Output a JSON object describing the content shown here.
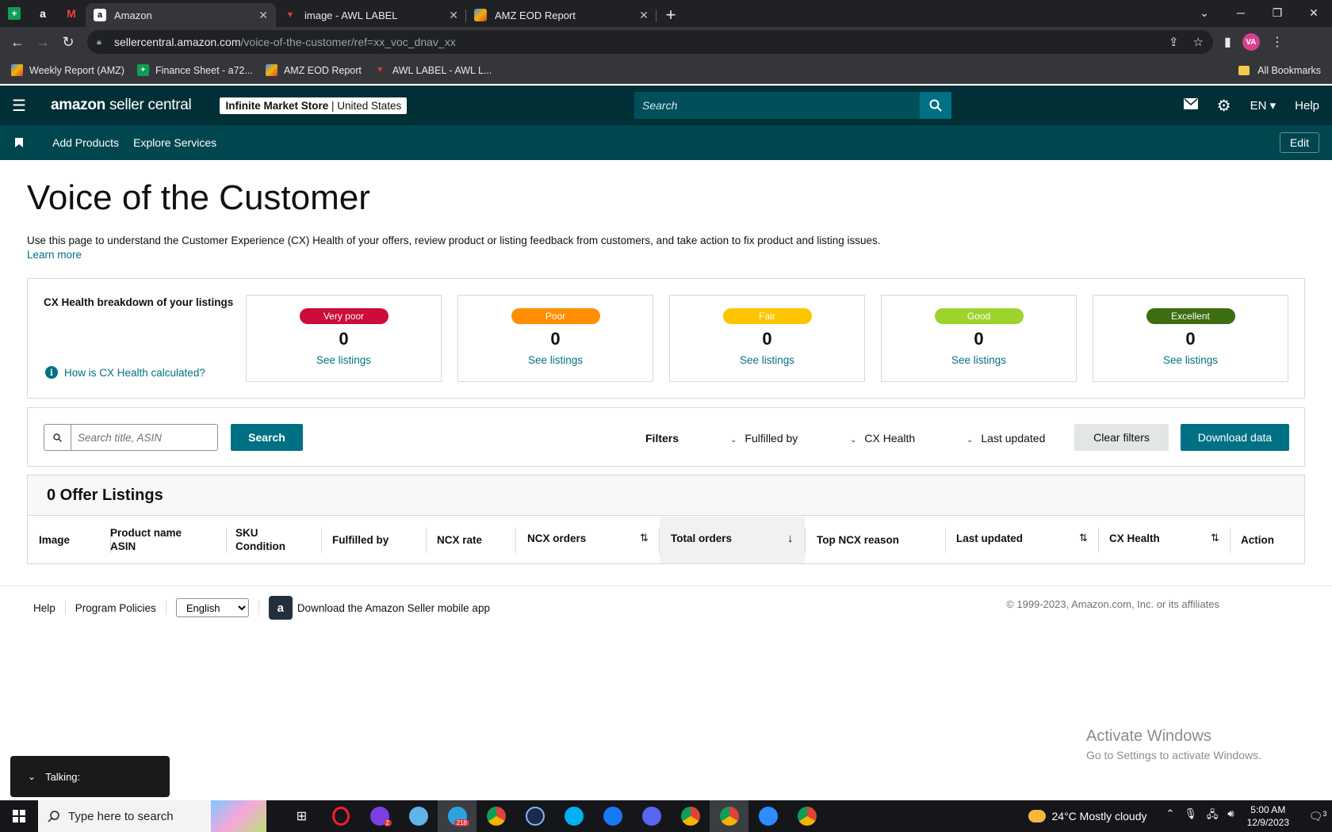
{
  "browser": {
    "pinned_tabs": [
      "sheets",
      "amazon",
      "gmail"
    ],
    "tabs": [
      {
        "title": "Amazon",
        "active": true
      },
      {
        "title": "image - AWL LABEL",
        "active": false
      },
      {
        "title": "AMZ EOD Report",
        "active": false
      }
    ],
    "url_host": "sellercentral.amazon.com",
    "url_path": "/voice-of-the-customer/ref=xx_voc_dnav_xx",
    "profile_initials": "VA",
    "bookmarks": [
      "Weekly Report (AMZ)",
      "Finance Sheet - a72...",
      "AMZ EOD Report",
      "AWL LABEL - AWL L..."
    ],
    "all_bookmarks": "All Bookmarks"
  },
  "header": {
    "logo_brand": "amazon",
    "logo_product": "seller central",
    "store_name": "Infinite Market Store",
    "store_region": "United States",
    "search_placeholder": "Search",
    "language": "EN",
    "help": "Help"
  },
  "subnav": {
    "links": [
      "Add Products",
      "Explore Services"
    ],
    "edit": "Edit"
  },
  "page": {
    "title": "Voice of the Customer",
    "description": "Use this page to understand the Customer Experience (CX) Health of your offers, review product or listing feedback from customers, and take action to fix product and listing issues.",
    "learn_more": "Learn more"
  },
  "cx_health": {
    "title": "CX Health breakdown of your listings",
    "how_link": "How is CX Health calculated?",
    "cards": [
      {
        "label": "Very poor",
        "count": "0",
        "link": "See listings",
        "color": "#cc0c39"
      },
      {
        "label": "Poor",
        "count": "0",
        "link": "See listings",
        "color": "#ff8f00"
      },
      {
        "label": "Fair",
        "count": "0",
        "link": "See listings",
        "color": "#ffc400"
      },
      {
        "label": "Good",
        "count": "0",
        "link": "See listings",
        "color": "#9ed32c"
      },
      {
        "label": "Excellent",
        "count": "0",
        "link": "See listings",
        "color": "#3c6e11"
      }
    ]
  },
  "filters": {
    "search_placeholder": "Search title, ASIN",
    "search_button": "Search",
    "filters_label": "Filters",
    "fulfilled_by": "Fulfilled by",
    "cx_health": "CX Health",
    "last_updated": "Last updated",
    "clear_filters": "Clear filters",
    "download_data": "Download data"
  },
  "listings": {
    "heading": "0 Offer Listings",
    "columns": [
      "Image",
      "Product name",
      "ASIN",
      "SKU",
      "Condition",
      "Fulfilled by",
      "NCX rate",
      "NCX orders",
      "Total orders",
      "Top NCX reason",
      "Last updated",
      "CX Health",
      "Action"
    ]
  },
  "footer": {
    "help": "Help",
    "policies": "Program Policies",
    "language": "English",
    "app_text": "Download the Amazon Seller mobile app",
    "copyright": "© 1999-2023, Amazon.com, Inc. or its affiliates"
  },
  "overlay": {
    "activate_title": "Activate Windows",
    "activate_sub": "Go to Settings to activate Windows.",
    "talking": "Talking:"
  },
  "taskbar": {
    "search_placeholder": "Type here to search",
    "badge_opera": "2",
    "badge_telegram": "218",
    "weather": "24°C  Mostly cloudy",
    "time": "5:00 AM",
    "date": "12/9/2023",
    "notifications": "3"
  }
}
